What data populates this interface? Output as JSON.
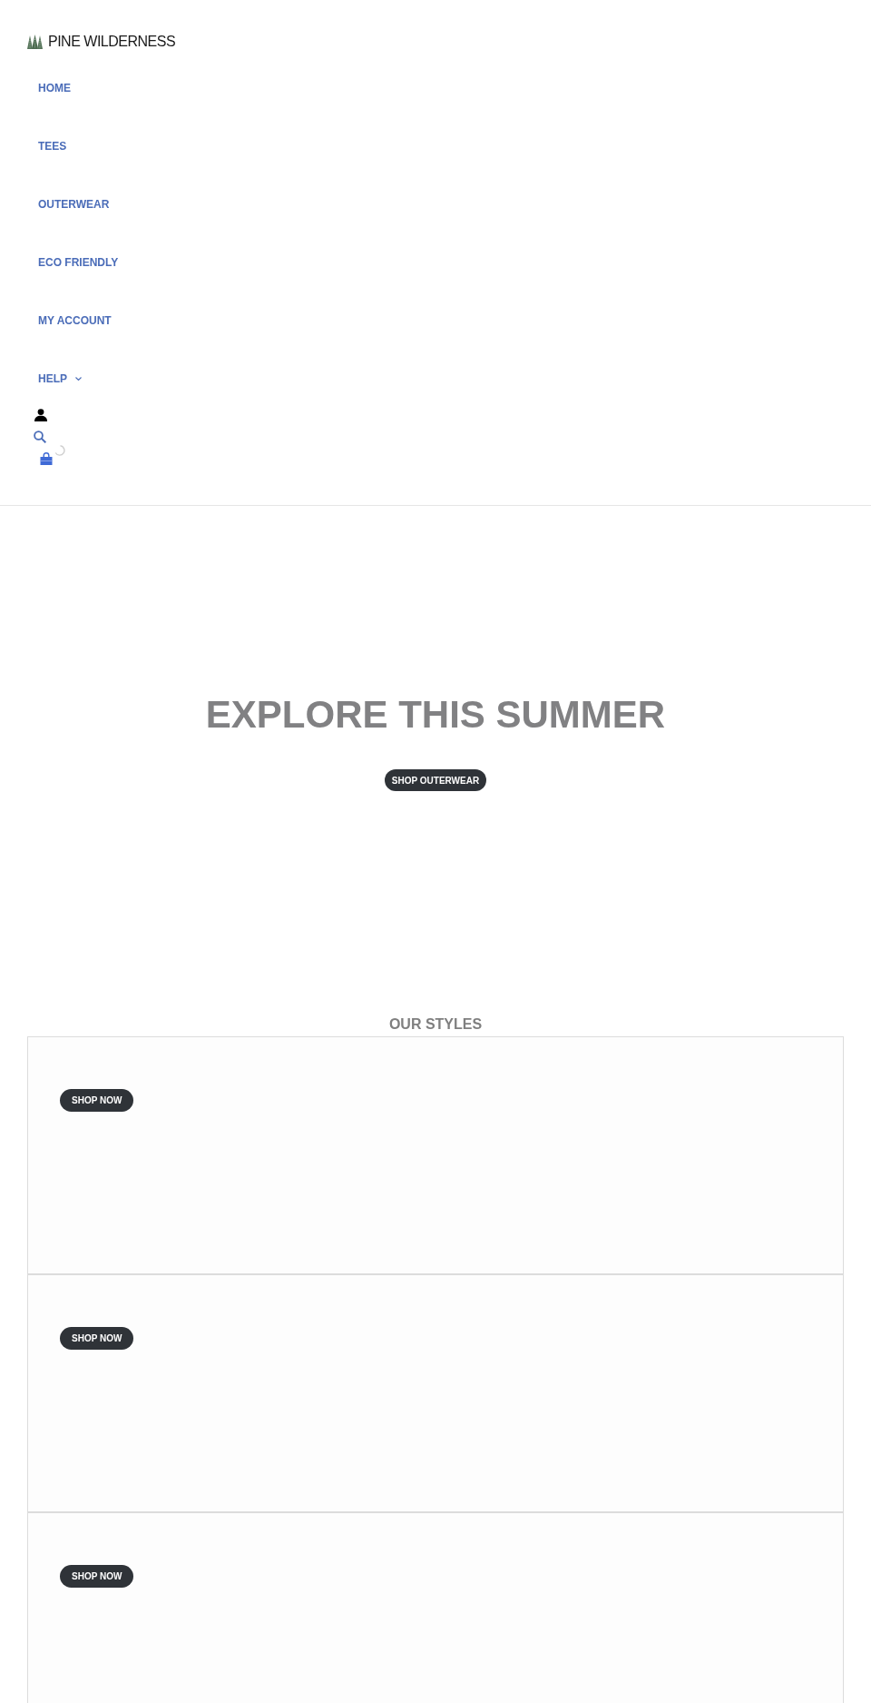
{
  "header": {
    "logo": "PINE WILDERNESS",
    "nav": [
      {
        "label": "HOME",
        "kind": "link"
      },
      {
        "label": "TEES",
        "kind": "link"
      },
      {
        "label": "OUTERWEAR",
        "kind": "link"
      },
      {
        "label": "ECO FRIENDLY",
        "kind": "link"
      },
      {
        "label": "MY ACCOUNT",
        "kind": "link"
      },
      {
        "label": "HELP",
        "kind": "dropdown"
      }
    ]
  },
  "hero": {
    "title": "EXPLORE THIS SUMMER",
    "button": "SHOP OUTERWEAR"
  },
  "styles": {
    "heading": "OUR STYLES",
    "cards": [
      {
        "button": "SHOP NOW"
      },
      {
        "button": "SHOP NOW"
      },
      {
        "button": "SHOP NOW"
      }
    ]
  }
}
